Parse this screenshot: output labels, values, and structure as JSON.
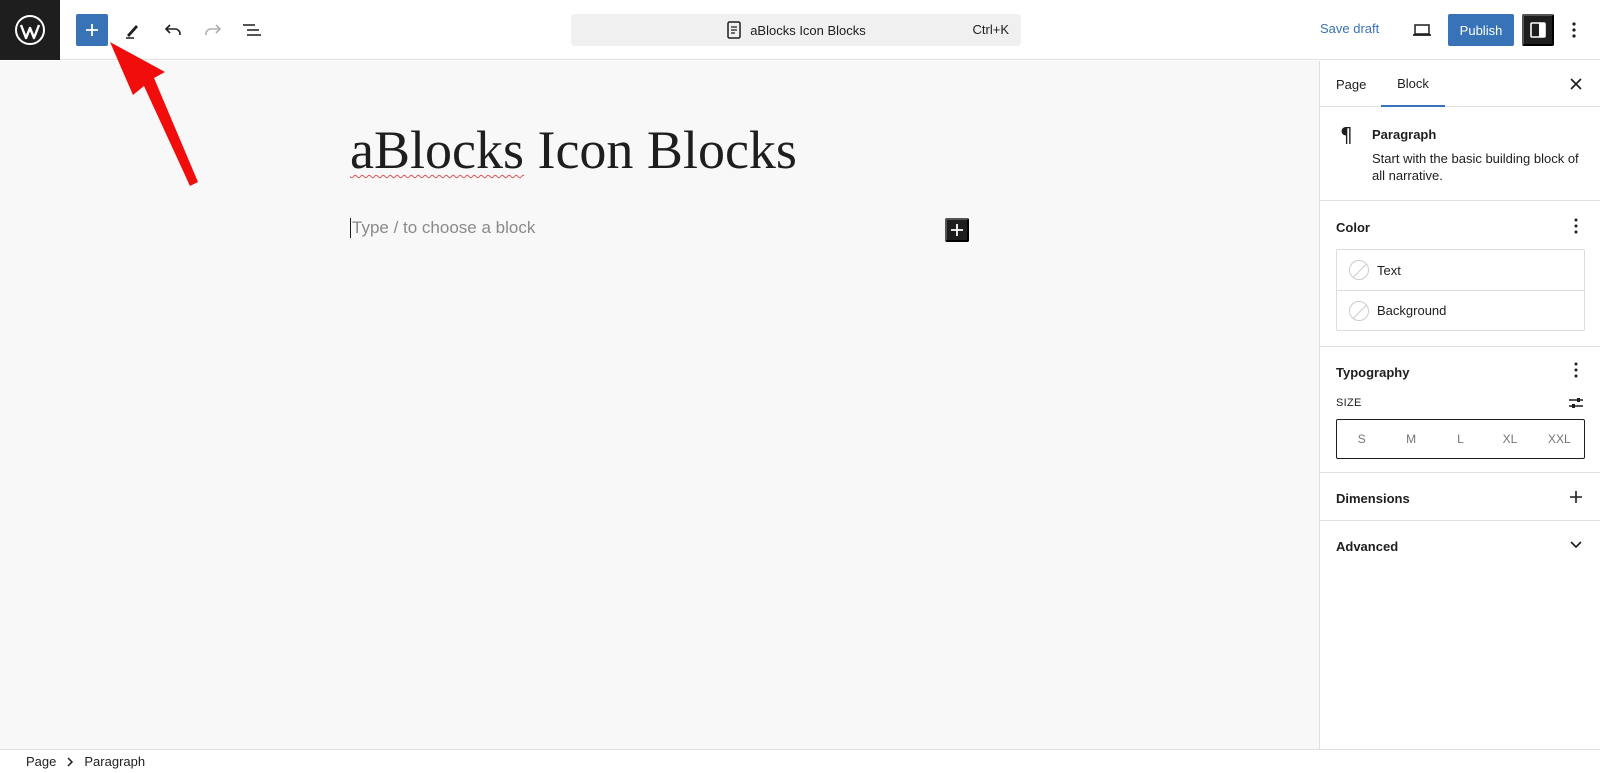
{
  "header": {
    "command_bar": {
      "title": "aBlocks Icon Blocks",
      "shortcut": "Ctrl+K"
    },
    "save_draft_label": "Save draft",
    "publish_label": "Publish"
  },
  "editor": {
    "title_part1": "aBlocks",
    "title_part2": " Icon Blocks",
    "block_placeholder": "Type / to choose a block"
  },
  "sidebar": {
    "tabs": [
      {
        "label": "Page"
      },
      {
        "label": "Block"
      }
    ],
    "active_tab": "Block",
    "block_card": {
      "name": "Paragraph",
      "description": "Start with the basic building block of all narrative."
    },
    "color": {
      "title": "Color",
      "items": [
        {
          "label": "Text"
        },
        {
          "label": "Background"
        }
      ]
    },
    "typography": {
      "title": "Typography",
      "size_label": "SIZE",
      "sizes": [
        "S",
        "M",
        "L",
        "XL",
        "XXL"
      ]
    },
    "dimensions": {
      "title": "Dimensions"
    },
    "advanced": {
      "title": "Advanced"
    }
  },
  "footer": {
    "breadcrumb": [
      "Page",
      "Paragraph"
    ]
  },
  "colors": {
    "accent": "#3873b8",
    "dark": "#1e1e1e",
    "annotation_arrow": "#f20d0d"
  }
}
